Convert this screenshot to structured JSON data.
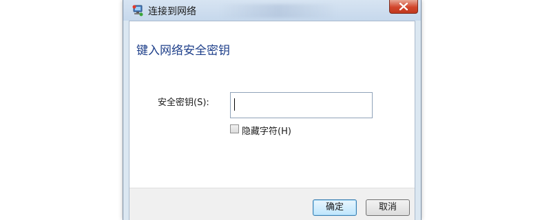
{
  "window": {
    "title": "连接到网络",
    "icon": "network-connect-icon"
  },
  "dialog": {
    "heading": "键入网络安全密钥",
    "key_label": "安全密钥(S):",
    "key_value": "",
    "hide_chars_label": "隐藏字符(H)",
    "hide_chars_checked": false
  },
  "buttons": {
    "ok": "确定",
    "cancel": "取消"
  },
  "colors": {
    "heading": "#1e3f8a",
    "close_button": "#d2462c",
    "frame": "#dbe7f1"
  }
}
